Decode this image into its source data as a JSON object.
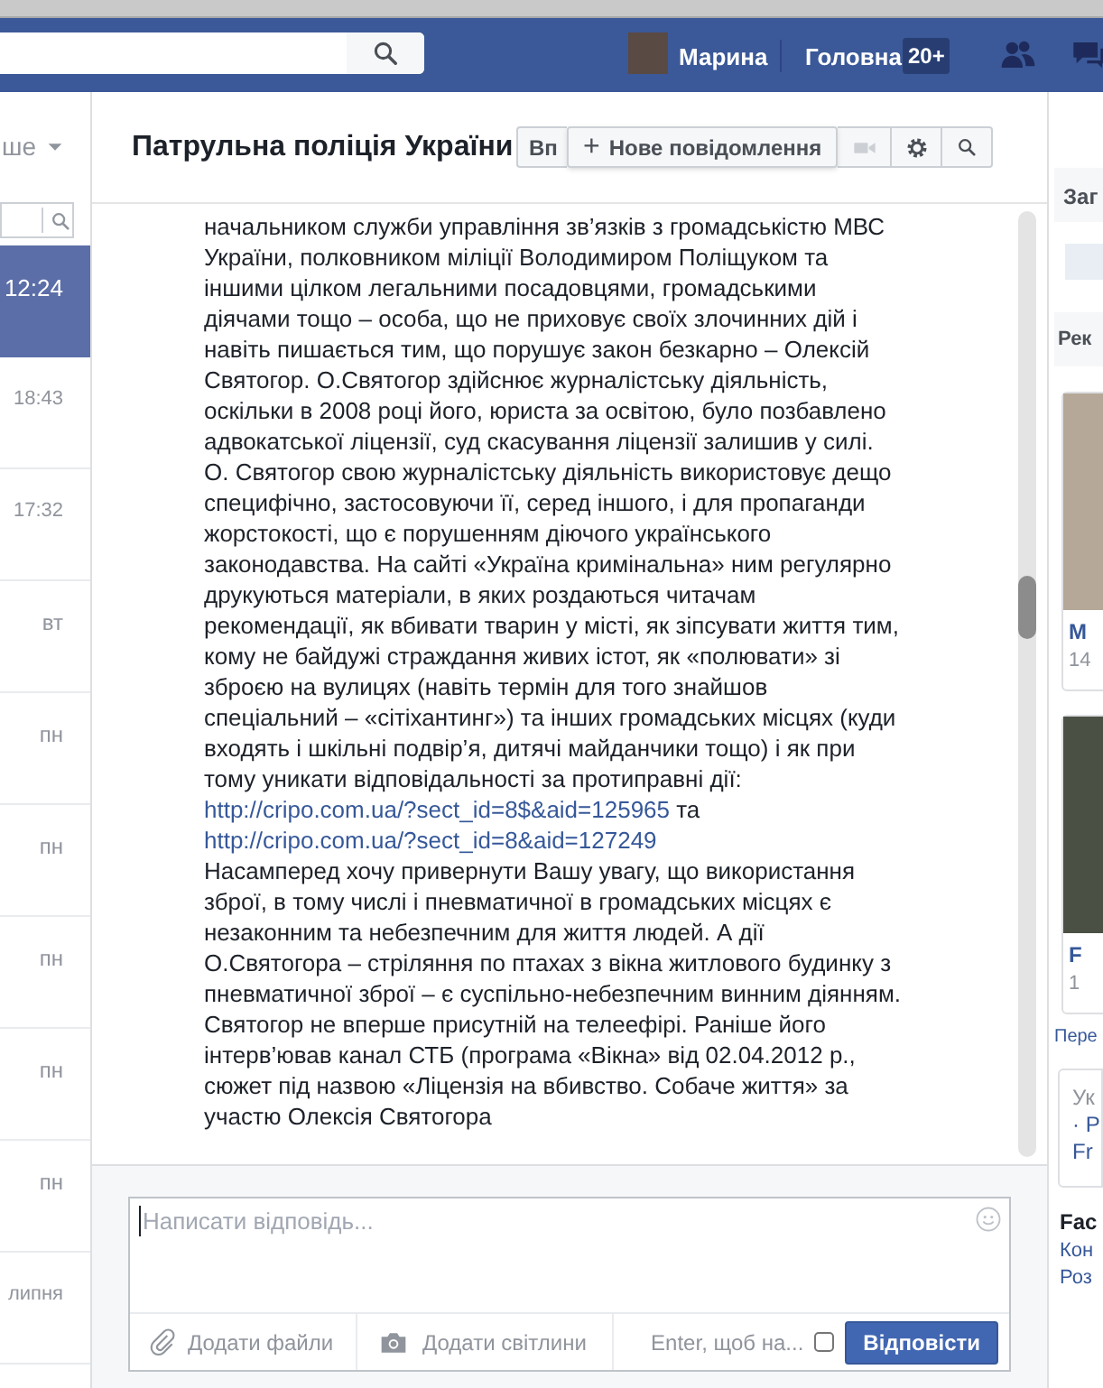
{
  "topbar": {
    "user": {
      "name": "Марина"
    },
    "home": {
      "label": "Головна",
      "badge": "20+"
    }
  },
  "sidebar": {
    "filter_label": "ше",
    "conversations": [
      {
        "time": "12:24",
        "selected": true
      },
      {
        "time": "18:43",
        "selected": false
      },
      {
        "time": "17:32",
        "selected": false
      },
      {
        "time": "вт",
        "selected": false
      },
      {
        "time": "пн",
        "selected": false
      },
      {
        "time": "пн",
        "selected": false
      },
      {
        "time": "пн",
        "selected": false
      },
      {
        "time": "пн",
        "selected": false
      },
      {
        "time": "пн",
        "selected": false
      },
      {
        "time": "липня",
        "selected": false
      }
    ]
  },
  "conversation": {
    "title": "Патрульна поліція України",
    "hidden_button": "Вп",
    "new_message": {
      "icon": "+",
      "label": "Нове повідомлення"
    },
    "message": [
      [
        {
          "kind": "text",
          "text": "начальником служби управління зв’язків з громадськістю МВС України, полковником міліції Володимиром Поліщуком та іншими цілком легальними посадовцями, громадськими діячами тощо – особа, що не приховує своїх злочинних дій і навіть пишається тим, що порушує закон безкарно – Олексій Святогор. О.Святогор здійснює журналістську діяльність, оскільки в 2008 році його, юриста за освітою, було позбавлено адвокатської ліцензії, суд скасування ліцензії залишив у силі."
        }
      ],
      [
        {
          "kind": "text",
          "text": "О. Святогор свою журналістську діяльність використовує дещо специфічно, застосовуючи її, серед іншого, і для пропаганди жорстокості, що є порушенням діючого українського законодавства. На сайті «Україна кримінальна» ним регулярно друкуються матеріали, в яких роздаються читачам рекомендації, як вбивати тварин у місті, як зіпсувати життя тим, кому не байдужі страждання живих істот, як «полювати» зі зброєю на вулицях (навіть термін для того знайшов спеціальний – «сітіхантинг») та інших громадських місцях (куди входять і шкільні подвір’я, дитячі майданчики тощо) і як при тому уникати відповідальності за протиправні дії: "
        },
        {
          "kind": "link",
          "text": "http://cripo.com.ua/?sect_id=8$&aid=125965"
        },
        {
          "kind": "text",
          "text": " та "
        },
        {
          "kind": "link",
          "text": "http://cripo.com.ua/?sect_id=8&aid=127249"
        }
      ],
      [
        {
          "kind": "text",
          "text": "Насамперед хочу привернути Вашу увагу, що використання зброї, в тому числі і пневматичної в громадських місцях є незаконним та небезпечним для життя людей. А дії О.Святогора – стріляння по птахах з вікна житлового будинку з пневматичної зброї – є суспільно-небезпечним винним діянням."
        }
      ],
      [
        {
          "kind": "text",
          "text": "Святогор не вперше присутній на телеефірі. Раніше його інтерв’ював канал СТБ (програма «Вікна» від 02.04.2012 р., сюжет під назвою «Ліцензія на вбивство. Собаче життя» за участю Олексія Святогора"
        }
      ]
    ],
    "reply": {
      "placeholder": "Написати відповідь...",
      "attach_files": "Додати файли",
      "attach_photos": "Додати світлини",
      "enter_to_send": {
        "label": "Enter, щоб на...",
        "checked": false
      },
      "send": "Відповісти"
    }
  },
  "right_column": {
    "section_1": "Заг",
    "section_2": "Рек",
    "card_1": {
      "title": "М",
      "subtitle": "14"
    },
    "card_2": {
      "title": "F",
      "subtitle": "1"
    },
    "link": "Пере",
    "box_lines": [
      "Ук",
      "· Р",
      "Fr"
    ],
    "footer_title": "Fac",
    "footer_links": [
      "Кон",
      "Роз"
    ]
  }
}
